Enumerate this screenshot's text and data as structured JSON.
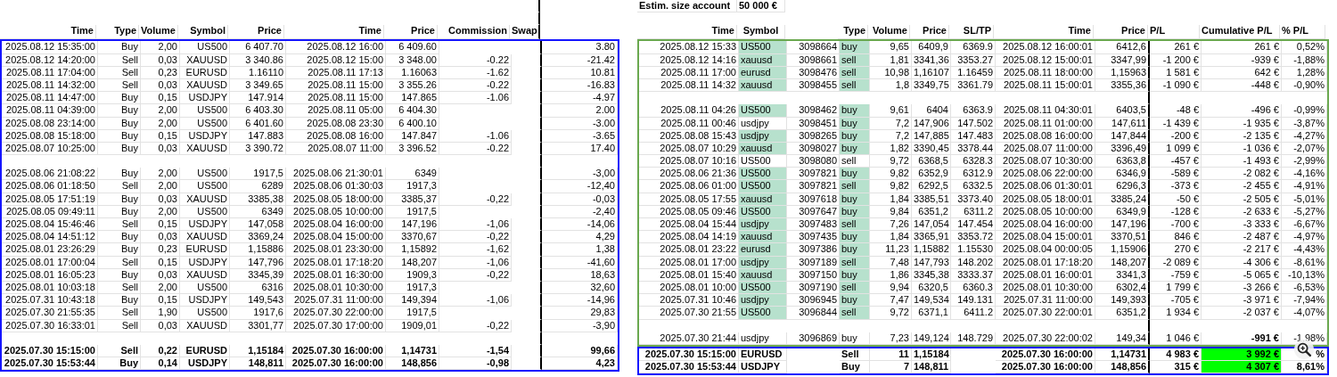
{
  "account": {
    "label": "Estim. size account",
    "value": "50 000 €"
  },
  "left_table": {
    "headers": [
      "Time",
      "Type",
      "Volume",
      "Symbol",
      "Price",
      "Time",
      "Price",
      "Commission",
      "Swap"
    ],
    "rows": [
      {
        "kind": "trade",
        "open_time": "2025.08.12 15:35:00",
        "type": "Buy",
        "volume": "2,00",
        "symbol": "US500",
        "open_price": "6 407.70",
        "close_time": "2025.08.12 16:00",
        "close_price": "6 409.60",
        "column_10": "3.80"
      },
      {
        "kind": "trade",
        "open_time": "2025.08.12 14:20:00",
        "type": "Sell",
        "volume": "0,03",
        "symbol": "XAUUSD",
        "open_price": "3 340.86",
        "close_time": "2025.08.12 15:00",
        "close_price": "3 348.00",
        "commission": "-0.22",
        "column_10": "-21.42"
      },
      {
        "kind": "trade",
        "open_time": "2025.08.11 17:04:00",
        "type": "Sell",
        "volume": "0,23",
        "symbol": "EURUSD",
        "open_price": "1.16110",
        "close_time": "2025.08.11 17:13",
        "close_price": "1.16063",
        "commission": "-1.62",
        "column_10": "10.81"
      },
      {
        "kind": "trade",
        "open_time": "2025.08.11 14:32:00",
        "type": "Sell",
        "volume": "0,03",
        "symbol": "XAUUSD",
        "open_price": "3 349.65",
        "close_time": "2025.08.11 15:00",
        "close_price": "3 355.26",
        "commission": "-0.22",
        "column_10": "-16.83"
      },
      {
        "kind": "trade",
        "open_time": "2025.08.11 14:47:00",
        "type": "Buy",
        "volume": "0,15",
        "symbol": "USDJPY",
        "open_price": "147.914",
        "close_time": "2025.08.11 15:00",
        "close_price": "147.865",
        "commission": "-1.06",
        "column_10": "-4.97"
      },
      {
        "kind": "trade",
        "open_time": "2025.08.11 04:39:00",
        "type": "Buy",
        "volume": "2,00",
        "symbol": "US500",
        "open_price": "6 403.30",
        "close_time": "2025.08.11 05:00",
        "close_price": "6 404.30",
        "column_10": "2.00"
      },
      {
        "kind": "trade",
        "open_time": "2025.08.08 23:14:00",
        "type": "Buy",
        "volume": "2,00",
        "symbol": "US500",
        "open_price": "6 401.60",
        "close_time": "2025.08.08 23:30",
        "close_price": "6 400.10",
        "column_10": "-3.00"
      },
      {
        "kind": "trade",
        "open_time": "2025.08.08 15:18:00",
        "type": "Buy",
        "volume": "0,15",
        "symbol": "USDJPY",
        "open_price": "147.883",
        "close_time": "2025.08.08 16:00",
        "close_price": "147.847",
        "commission": "-1.06",
        "column_10": "-3.65"
      },
      {
        "kind": "trade",
        "open_time": "2025.08.07 10:25:00",
        "type": "Buy",
        "volume": "0,03",
        "symbol": "XAUUSD",
        "open_price": "3 390.72",
        "close_time": "2025.08.07 11:00",
        "close_price": "3 396.52",
        "commission": "-0.22",
        "column_10": "17.40"
      },
      {
        "kind": "blank"
      },
      {
        "kind": "trade",
        "open_time": "2025.08.06 21:08:22",
        "type": "Buy",
        "volume": "2,00",
        "symbol": "US500",
        "open_price": "1917,5",
        "close_time": "2025.08.06 21:30:01",
        "close_price": "6349",
        "column_10": "-3,00"
      },
      {
        "kind": "trade",
        "open_time": "2025.08.06 01:18:50",
        "type": "Sell",
        "volume": "2,00",
        "symbol": "US500",
        "open_price": "6289",
        "close_time": "2025.08.06 01:30:03",
        "close_price": "1917,3",
        "column_10": "-12,40"
      },
      {
        "kind": "trade",
        "open_time": "2025.08.05 17:51:19",
        "type": "Buy",
        "volume": "0,03",
        "symbol": "XAUUSD",
        "open_price": "3385,38",
        "close_time": "2025.08.05 18:00:00",
        "close_price": "3385,37",
        "commission": "-0,22",
        "column_10": "-0,03"
      },
      {
        "kind": "trade",
        "open_time": "2025.08.05 09:49:11",
        "type": "Buy",
        "volume": "2,00",
        "symbol": "US500",
        "open_price": "6349",
        "close_time": "2025.08.05 10:00:00",
        "close_price": "1917,5",
        "column_10": "-2,40"
      },
      {
        "kind": "trade",
        "open_time": "2025.08.04 15:46:46",
        "type": "Sell",
        "volume": "0,15",
        "symbol": "USDJPY",
        "open_price": "147,058",
        "close_time": "2025.08.04 16:00:00",
        "close_price": "147,196",
        "commission": "-1,06",
        "column_10": "-14,06"
      },
      {
        "kind": "trade",
        "open_time": "2025.08.04 14:51:12",
        "type": "Buy",
        "volume": "0,03",
        "symbol": "XAUUSD",
        "open_price": "3369,24",
        "close_time": "2025.08.04 15:00:00",
        "close_price": "3370,67",
        "commission": "-0,22",
        "column_10": "4,29"
      },
      {
        "kind": "trade",
        "open_time": "2025.08.01 23:26:29",
        "type": "Buy",
        "volume": "0,23",
        "symbol": "EURUSD",
        "open_price": "1,15886",
        "close_time": "2025.08.01 23:30:00",
        "close_price": "1,15892",
        "commission": "-1,62",
        "column_10": "1,38"
      },
      {
        "kind": "trade",
        "open_time": "2025.08.01 17:00:04",
        "type": "Sell",
        "volume": "0,15",
        "symbol": "USDJPY",
        "open_price": "147,796",
        "close_time": "2025.08.01 17:18:20",
        "close_price": "148,207",
        "commission": "-1,06",
        "column_10": "-41,60"
      },
      {
        "kind": "trade",
        "open_time": "2025.08.01 16:05:23",
        "type": "Buy",
        "volume": "0,03",
        "symbol": "XAUUSD",
        "open_price": "3345,39",
        "close_time": "2025.08.01 16:30:00",
        "close_price": "1909,3",
        "commission": "-0,22",
        "column_10": "18,63"
      },
      {
        "kind": "trade",
        "open_time": "2025.08.01 10:03:18",
        "type": "Sell",
        "volume": "2,00",
        "symbol": "US500",
        "open_price": "6316",
        "close_time": "2025.08.01 10:30:00",
        "close_price": "1917,3",
        "column_10": "32,60"
      },
      {
        "kind": "trade",
        "open_time": "2025.07.31 10:43:18",
        "type": "Buy",
        "volume": "0,15",
        "symbol": "USDJPY",
        "open_price": "149,543",
        "close_time": "2025.07.31 11:00:00",
        "close_price": "149,394",
        "commission": "-1,06",
        "column_10": "-14,96"
      },
      {
        "kind": "trade",
        "open_time": "2025.07.30 21:55:35",
        "type": "Sell",
        "volume": "1,90",
        "symbol": "US500",
        "open_price": "1917,6",
        "close_time": "2025.07.30 22:00:00",
        "close_price": "1917,5",
        "column_10": "29,83"
      },
      {
        "kind": "trade",
        "open_time": "2025.07.30 16:33:01",
        "type": "Sell",
        "volume": "0,03",
        "symbol": "XAUUSD",
        "open_price": "3301,77",
        "close_time": "2025.07.30 17:00:00",
        "close_price": "1909,01",
        "commission": "-0,22",
        "column_10": "-3,90"
      },
      {
        "kind": "blank"
      },
      {
        "kind": "summary",
        "open_time": "2025.07.30 15:15:00",
        "type": "Sell",
        "volume": "0,22",
        "symbol": "EURUSD",
        "open_price": "1,15184",
        "close_time": "2025.07.30 16:00:00",
        "close_price": "1,14731",
        "commission": "-1,54",
        "column_10": "99,66"
      },
      {
        "kind": "summary",
        "open_time": "2025.07.30 15:53:44",
        "type": "Buy",
        "volume": "0,14",
        "symbol": "USDJPY",
        "open_price": "148,811",
        "close_time": "2025.07.30 16:00:00",
        "close_price": "148,856",
        "commission": "-0,98",
        "column_10": "4,23"
      }
    ]
  },
  "right_table": {
    "headers": [
      "Time",
      "Symbol",
      "Type",
      "Volume",
      "Price",
      "SL/TP",
      "Time",
      "Price",
      "P/L",
      "Cumulative P/L",
      "% P/L"
    ],
    "rows": [
      {
        "kind": "trade",
        "time": "2025.08.12 15:33",
        "symbol": "US500",
        "column_3": "3098664",
        "type": "buy",
        "volume": "9,65",
        "price": "6409,9",
        "sl_tp": "6369.9",
        "close_time": "2025.08.12 16:00:01",
        "close_price": "6412,6",
        "pl": "261 €",
        "cumulative_pl": "261 €",
        "pct_pl": "0,52%",
        "symbol_highlighted": true,
        "type_highlighted": true
      },
      {
        "kind": "trade",
        "time": "2025.08.12 14:16",
        "symbol": "xauusd",
        "column_3": "3098661",
        "type": "sell",
        "volume": "1,81",
        "price": "3341,36",
        "sl_tp": "3353.27",
        "close_time": "2025.08.12 15:00:01",
        "close_price": "3347,99",
        "pl": "-1 200 €",
        "cumulative_pl": "-939 €",
        "pct_pl": "-1,88%",
        "symbol_highlighted": true,
        "type_highlighted": true
      },
      {
        "kind": "trade",
        "time": "2025.08.11 17:00",
        "symbol": "eurusd",
        "column_3": "3098476",
        "type": "sell",
        "volume": "10,98",
        "price": "1,16107",
        "sl_tp": "1.16459",
        "close_time": "2025.08.11 18:00:00",
        "close_price": "1,15963",
        "pl": "1 581 €",
        "cumulative_pl": "642 €",
        "pct_pl": "1,28%",
        "symbol_highlighted": true,
        "type_highlighted": true
      },
      {
        "kind": "trade",
        "time": "2025.08.11 14:32",
        "symbol": "xauusd",
        "column_3": "3098455",
        "type": "sell",
        "volume": "1,8",
        "price": "3349,75",
        "sl_tp": "3361.79",
        "close_time": "2025.08.11 15:00:01",
        "close_price": "3355,36",
        "pl": "-1 090 €",
        "cumulative_pl": "-448 €",
        "pct_pl": "-0,90%",
        "symbol_highlighted": true,
        "type_highlighted": true
      },
      {
        "kind": "blank"
      },
      {
        "kind": "trade",
        "time": "2025.08.11 04:26",
        "symbol": "US500",
        "column_3": "3098462",
        "type": "buy",
        "volume": "9,61",
        "price": "6404",
        "sl_tp": "6363.9",
        "close_time": "2025.08.11 04:30:01",
        "close_price": "6403,5",
        "pl": "-48 €",
        "cumulative_pl": "-496 €",
        "pct_pl": "-0,99%",
        "symbol_highlighted": true,
        "type_highlighted": true
      },
      {
        "kind": "trade",
        "time": "2025.08.11 00:46",
        "symbol": "usdjpy",
        "column_3": "3098451",
        "type": "buy",
        "volume": "7,2",
        "price": "147,906",
        "sl_tp": "147.502",
        "close_time": "2025.08.11 01:00:00",
        "close_price": "147,611",
        "pl": "-1 439 €",
        "cumulative_pl": "-1 935 €",
        "pct_pl": "-3,87%",
        "symbol_highlighted": false,
        "type_highlighted": true
      },
      {
        "kind": "trade",
        "time": "2025.08.08 15:43",
        "symbol": "usdjpy",
        "column_3": "3098265",
        "type": "buy",
        "volume": "7,2",
        "price": "147,885",
        "sl_tp": "147.483",
        "close_time": "2025.08.08 16:00:00",
        "close_price": "147,844",
        "pl": "-200 €",
        "cumulative_pl": "-2 135 €",
        "pct_pl": "-4,27%",
        "symbol_highlighted": true,
        "type_highlighted": true
      },
      {
        "kind": "trade",
        "time": "2025.08.07 10:29",
        "symbol": "xauusd",
        "column_3": "3098027",
        "type": "buy",
        "volume": "1,82",
        "price": "3390,45",
        "sl_tp": "3378.44",
        "close_time": "2025.08.07 11:00:00",
        "close_price": "3396,49",
        "pl": "1 099 €",
        "cumulative_pl": "-1 036 €",
        "pct_pl": "-2,07%",
        "symbol_highlighted": true,
        "type_highlighted": true
      },
      {
        "kind": "trade",
        "time": "2025.08.07 10:16",
        "symbol": "US500",
        "column_3": "3098080",
        "type": "sell",
        "volume": "9,72",
        "price": "6368,5",
        "sl_tp": "6328.3",
        "close_time": "2025.08.07 10:30:00",
        "close_price": "6363,8",
        "pl": "-457 €",
        "cumulative_pl": "-1 493 €",
        "pct_pl": "-2,99%",
        "symbol_highlighted": false,
        "type_highlighted": false
      },
      {
        "kind": "trade",
        "time": "2025.08.06 21:36",
        "symbol": "US500",
        "column_3": "3097821",
        "type": "buy",
        "volume": "9,82",
        "price": "6352,9",
        "sl_tp": "6312.9",
        "close_time": "2025.08.06 22:00:00",
        "close_price": "6346,9",
        "pl": "-589 €",
        "cumulative_pl": "-2 082 €",
        "pct_pl": "-4,16%",
        "symbol_highlighted": true,
        "type_highlighted": true
      },
      {
        "kind": "trade",
        "time": "2025.08.06 01:00",
        "symbol": "US500",
        "column_3": "3097821",
        "type": "sell",
        "volume": "9,82",
        "price": "6292,5",
        "sl_tp": "6332.5",
        "close_time": "2025.08.06 01:30:01",
        "close_price": "6296,3",
        "pl": "-373 €",
        "cumulative_pl": "-2 455 €",
        "pct_pl": "-4,91%",
        "symbol_highlighted": true,
        "type_highlighted": true
      },
      {
        "kind": "trade",
        "time": "2025.08.05 17:55",
        "symbol": "xauusd",
        "column_3": "3097618",
        "type": "buy",
        "volume": "1,84",
        "price": "3385,51",
        "sl_tp": "3373.40",
        "close_time": "2025.08.05 18:00:01",
        "close_price": "3385,24",
        "pl": "-50 €",
        "cumulative_pl": "-2 505 €",
        "pct_pl": "-5,01%",
        "symbol_highlighted": true,
        "type_highlighted": true
      },
      {
        "kind": "trade",
        "time": "2025.08.05 09:46",
        "symbol": "US500",
        "column_3": "3097647",
        "type": "buy",
        "volume": "9,84",
        "price": "6351,2",
        "sl_tp": "6311.2",
        "close_time": "2025.08.05 10:00:00",
        "close_price": "6349,9",
        "pl": "-128 €",
        "cumulative_pl": "-2 633 €",
        "pct_pl": "-5,27%",
        "symbol_highlighted": true,
        "type_highlighted": true
      },
      {
        "kind": "trade",
        "time": "2025.08.04 15:44",
        "symbol": "usdjpy",
        "column_3": "3097483",
        "type": "sell",
        "volume": "7,26",
        "price": "147,054",
        "sl_tp": "147.454",
        "close_time": "2025.08.04 16:00:00",
        "close_price": "147,196",
        "pl": "-700 €",
        "cumulative_pl": "-3 333 €",
        "pct_pl": "-6,67%",
        "symbol_highlighted": true,
        "type_highlighted": true
      },
      {
        "kind": "trade",
        "time": "2025.08.04 14:19",
        "symbol": "xauusd",
        "column_3": "3097435",
        "type": "buy",
        "volume": "1,84",
        "price": "3365,91",
        "sl_tp": "3353.72",
        "close_time": "2025.08.04 15:00:01",
        "close_price": "3370,51",
        "pl": "846 €",
        "cumulative_pl": "-2 487 €",
        "pct_pl": "-4,97%",
        "symbol_highlighted": true,
        "type_highlighted": true
      },
      {
        "kind": "trade",
        "time": "2025.08.01 23:22",
        "symbol": "eurusd",
        "column_3": "3097386",
        "type": "buy",
        "volume": "11,23",
        "price": "1,15882",
        "sl_tp": "1.15530",
        "close_time": "2025.08.04 00:00:05",
        "close_price": "1,15906",
        "pl": "270 €",
        "cumulative_pl": "-2 217 €",
        "pct_pl": "-4,43%",
        "symbol_highlighted": true,
        "type_highlighted": true
      },
      {
        "kind": "trade",
        "time": "2025.08.01 17:00",
        "symbol": "usdjpy",
        "column_3": "3097189",
        "type": "sell",
        "volume": "7,48",
        "price": "147,793",
        "sl_tp": "148.202",
        "close_time": "2025.08.01 17:18:20",
        "close_price": "148,207",
        "pl": "-2 089 €",
        "cumulative_pl": "-4 306 €",
        "pct_pl": "-8,61%",
        "symbol_highlighted": true,
        "type_highlighted": true
      },
      {
        "kind": "trade",
        "time": "2025.08.01 15:40",
        "symbol": "xauusd",
        "column_3": "3097150",
        "type": "buy",
        "volume": "1,86",
        "price": "3345,38",
        "sl_tp": "3333.37",
        "close_time": "2025.08.01 16:00:01",
        "close_price": "3341,3",
        "pl": "-759 €",
        "cumulative_pl": "-5 065 €",
        "pct_pl": "-10,13%",
        "symbol_highlighted": true,
        "type_highlighted": true
      },
      {
        "kind": "trade",
        "time": "2025.08.01 10:00",
        "symbol": "US500",
        "column_3": "3097190",
        "type": "sell",
        "volume": "9,94",
        "price": "6320,5",
        "sl_tp": "6360.3",
        "close_time": "2025.08.01 10:30:00",
        "close_price": "6302,4",
        "pl": "1 799 €",
        "cumulative_pl": "-3 266 €",
        "pct_pl": "-6,53%",
        "symbol_highlighted": true,
        "type_highlighted": true
      },
      {
        "kind": "trade",
        "time": "2025.07.31 10:46",
        "symbol": "usdjpy",
        "column_3": "3096945",
        "type": "buy",
        "volume": "7,47",
        "price": "149,534",
        "sl_tp": "149.131",
        "close_time": "2025.07.31 11:00:00",
        "close_price": "149,393",
        "pl": "-705 €",
        "cumulative_pl": "-3 971 €",
        "pct_pl": "-7,94%",
        "symbol_highlighted": true,
        "type_highlighted": true
      },
      {
        "kind": "trade",
        "time": "2025.07.30 21:55",
        "symbol": "US500",
        "column_3": "3096844",
        "type": "sell",
        "volume": "9,72",
        "price": "6371,1",
        "sl_tp": "6411.2",
        "close_time": "2025.07.30 22:00:01",
        "close_price": "6351,2",
        "pl": "1 934 €",
        "cumulative_pl": "-2 037 €",
        "pct_pl": "-4,07%",
        "symbol_highlighted": true,
        "type_highlighted": true
      },
      {
        "kind": "blank"
      },
      {
        "kind": "trade",
        "time": "2025.07.30 21:44",
        "symbol": "usdjpy",
        "column_3": "3096869",
        "type": "buy",
        "volume": "7,23",
        "price": "149,124",
        "sl_tp": "148.729",
        "close_time": "2025.07.30 22:00:02",
        "close_price": "149,34",
        "pl": "1 046 €",
        "cumulative_pl": "-991 €",
        "pct_pl": "-1,98%",
        "symbol_highlighted": false,
        "type_highlighted": false,
        "cumulative_bold": true
      },
      {
        "kind": "summary",
        "time": "2025.07.30 15:15:00",
        "symbol": "EURUSD",
        "type": "Sell",
        "volume": "11",
        "price": "1,15184",
        "close_time": "2025.07.30 16:00:00",
        "close_price": "1,14731",
        "pl": "4 983 €",
        "cumulative_pl": "3 992 €",
        "pct_pl": "%",
        "cumulative_highlighted": true
      },
      {
        "kind": "summary",
        "time": "2025.07.30 15:53:44",
        "symbol": "USDJPY",
        "type": "Buy",
        "volume": "7",
        "price": "148,811",
        "close_time": "2025.07.30 16:00:00",
        "close_price": "148,856",
        "pl": "315 €",
        "cumulative_pl": "4 307 €",
        "pct_pl": "8,61%",
        "cumulative_highlighted": true
      }
    ]
  }
}
